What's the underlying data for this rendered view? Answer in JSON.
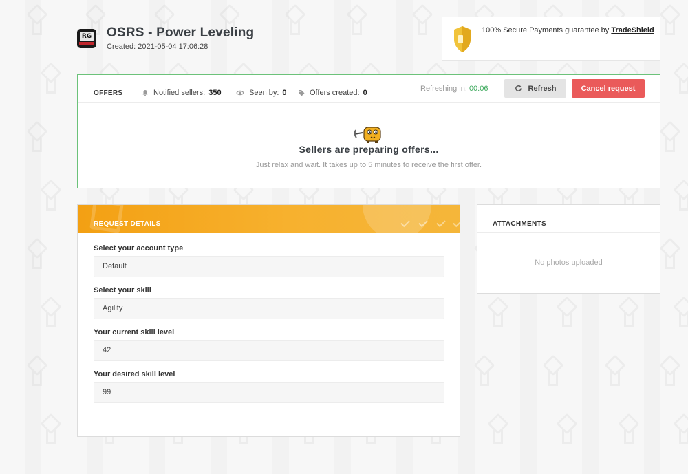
{
  "header": {
    "title": "OSRS - Power Leveling",
    "created": "Created: 2021-05-04 17:06:28",
    "logo_icon": "game-logo-icon"
  },
  "secure": {
    "text": "100% Secure Payments guarantee by",
    "link": "TradeShield",
    "icon": "shield-icon"
  },
  "offers": {
    "label": "OFFERS",
    "notified_label": "Notified sellers:",
    "notified_value": "350",
    "seen_label": "Seen by:",
    "seen_value": "0",
    "created_label": "Offers created:",
    "created_value": "0",
    "refreshing_label": "Refreshing in:",
    "refreshing_timer": "00:06",
    "refresh_button": "Refresh",
    "cancel_button": "Cancel request",
    "empty_title": "Sellers are preparing offers...",
    "empty_subtitle": "Just relax and wait. It takes up to 5 minutes to receive the first offer.",
    "border_color": "#6cc27a",
    "cancel_color": "#ea5a5a"
  },
  "request_details": {
    "title": "REQUEST DETAILS",
    "header_color": "#f3a013",
    "fields": [
      {
        "label": "Select your account type",
        "value": "Default"
      },
      {
        "label": "Select your skill",
        "value": "Agility"
      },
      {
        "label": "Your current skill level",
        "value": "42"
      },
      {
        "label": "Your desired skill level",
        "value": "99"
      }
    ]
  },
  "attachments": {
    "title": "ATTACHMENTS",
    "empty": "No photos uploaded"
  }
}
